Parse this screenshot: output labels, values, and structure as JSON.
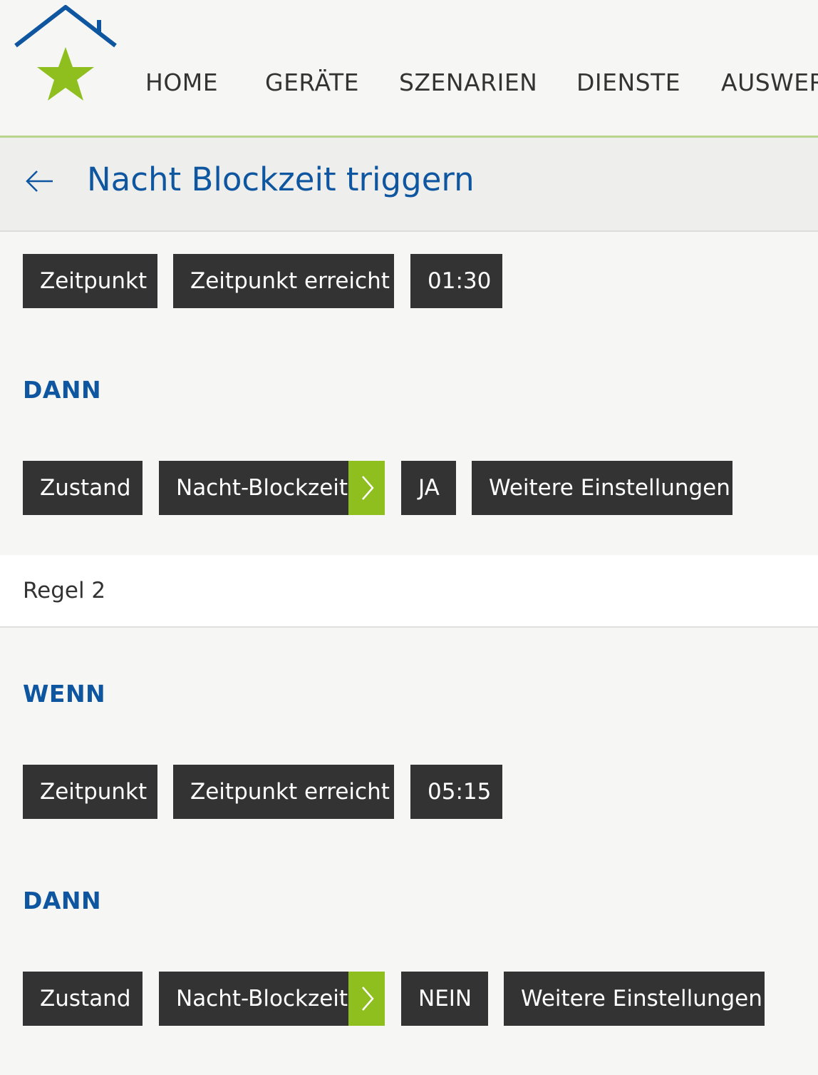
{
  "nav": {
    "items": [
      "HOME",
      "GERÄTE",
      "SZENARIEN",
      "DIENSTE",
      "AUSWER"
    ]
  },
  "page": {
    "title": "Nacht Blockzeit triggern"
  },
  "rule1": {
    "when_chips": [
      "Zeitpunkt",
      "Zeitpunkt erreicht",
      "01:30"
    ],
    "then_label": "DANN",
    "then_chips": [
      "Zustand",
      "Nacht-Blockzeit",
      "JA",
      "Weitere Einstellungen"
    ]
  },
  "rule2": {
    "label": "Regel 2",
    "when_label": "WENN",
    "when_chips": [
      "Zeitpunkt",
      "Zeitpunkt erreicht",
      "05:15"
    ],
    "then_label": "DANN",
    "then_chips": [
      "Zustand",
      "Nacht-Blockzeit",
      "NEIN",
      "Weitere Einstellungen"
    ]
  },
  "colors": {
    "brand_blue": "#0f56a0",
    "accent_green": "#8ebf1e",
    "chip_bg": "#333333"
  }
}
